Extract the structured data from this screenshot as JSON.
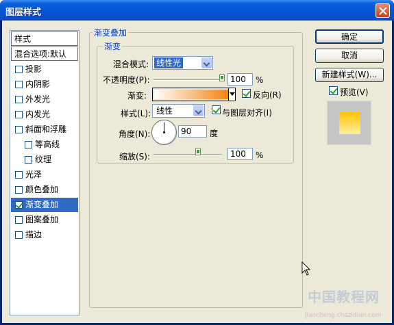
{
  "window": {
    "title": "图层样式"
  },
  "sidebar": {
    "header": "样式",
    "blend_default": "混合选项:默认",
    "items": [
      {
        "label": "投影",
        "checked": false,
        "indent": false
      },
      {
        "label": "内阴影",
        "checked": false,
        "indent": false
      },
      {
        "label": "外发光",
        "checked": false,
        "indent": false
      },
      {
        "label": "内发光",
        "checked": false,
        "indent": false
      },
      {
        "label": "斜面和浮雕",
        "checked": false,
        "indent": false
      },
      {
        "label": "等高线",
        "checked": false,
        "indent": true
      },
      {
        "label": "纹理",
        "checked": false,
        "indent": true
      },
      {
        "label": "光泽",
        "checked": false,
        "indent": false
      },
      {
        "label": "颜色叠加",
        "checked": false,
        "indent": false
      },
      {
        "label": "渐变叠加",
        "checked": true,
        "indent": false,
        "selected": true
      },
      {
        "label": "图案叠加",
        "checked": false,
        "indent": false
      },
      {
        "label": "描边",
        "checked": false,
        "indent": false
      }
    ]
  },
  "panel": {
    "group_title": "渐变叠加",
    "sub_title": "渐变",
    "blend_mode_label": "混合模式:",
    "blend_mode_value": "线性光",
    "opacity_label": "不透明度(P):",
    "opacity_value": "100",
    "opacity_unit": "%",
    "opacity_level": 1.0,
    "gradient_label": "渐变:",
    "reverse_label": "反向(R)",
    "reverse_checked": true,
    "style_label": "样式(L):",
    "style_value": "线性",
    "align_label": "与图层对齐(I)",
    "align_checked": true,
    "angle_label": "角度(N):",
    "angle_value": "90",
    "angle_unit": "度",
    "scale_label": "缩放(S):",
    "scale_value": "100",
    "scale_unit": "%",
    "scale_level": 0.5
  },
  "buttons": {
    "ok": "确定",
    "cancel": "取消",
    "new_style": "新建样式(W)...",
    "preview_label": "预览(V)",
    "preview_checked": true
  },
  "watermark": {
    "line1": "中国教程网",
    "line2": "jiaocheng.chazidian.com"
  },
  "colors": {
    "accent": "#316ac5",
    "title_blue": "#0046d5",
    "gradient_start": "#ffffff",
    "gradient_end": "#f47b00"
  }
}
